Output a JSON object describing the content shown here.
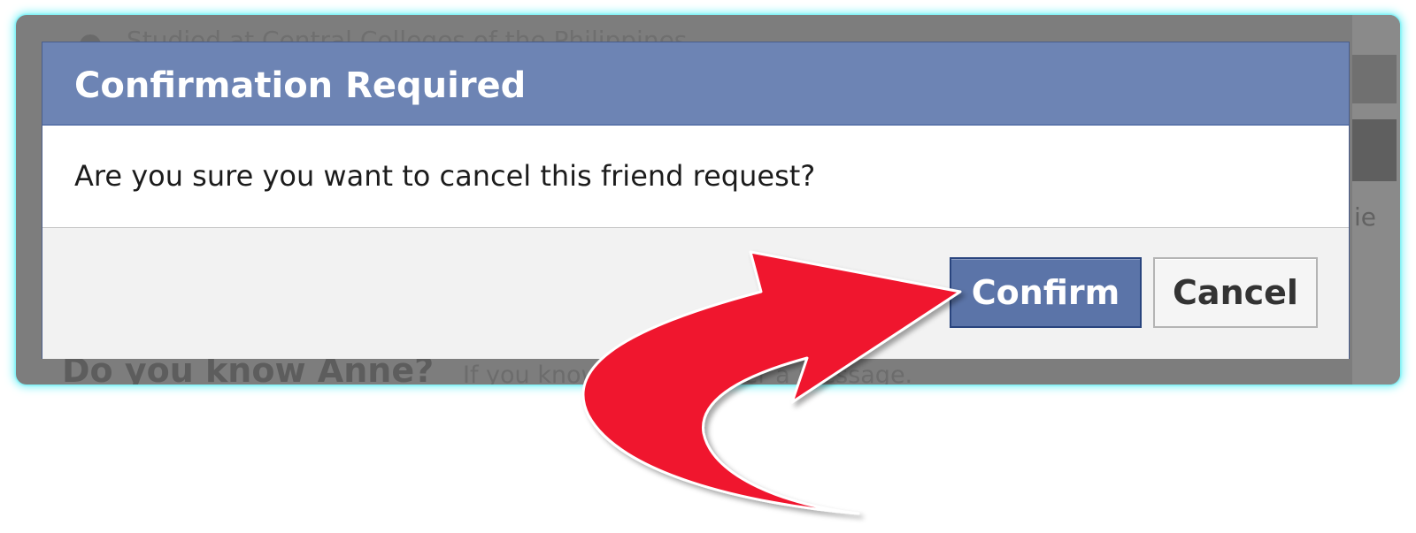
{
  "background": {
    "top_text": "Studied at Central Colleges of the Philippines",
    "bottom_left_text": "Do you know Anne?",
    "bottom_right_text": "If you know her, send her a message.",
    "right_edge_text": "ie"
  },
  "dialog": {
    "title": "Confirmation Required",
    "message": "Are you sure you want to cancel this friend request?",
    "confirm_label": "Confirm",
    "cancel_label": "Cancel"
  },
  "colors": {
    "header": "#6d84b4",
    "confirm_button": "#5b74a8",
    "arrow": "#f0142f",
    "glow": "#7ff3f8"
  },
  "annotation": {
    "arrow_icon": "curved-arrow-icon"
  }
}
